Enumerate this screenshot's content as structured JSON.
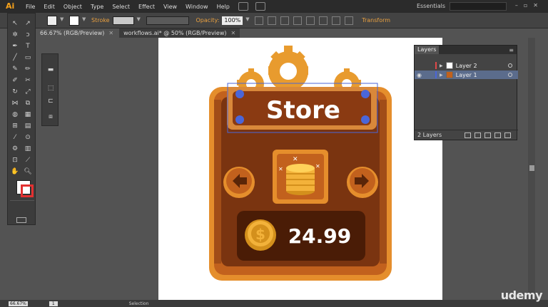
{
  "app": {
    "logo": "Ai"
  },
  "menu": [
    "File",
    "Edit",
    "Object",
    "Type",
    "Select",
    "Effect",
    "View",
    "Window",
    "Help"
  ],
  "workspace": "Essentials",
  "control_bar": {
    "stroke_label": "Stroke",
    "opacity_label": "Opacity:",
    "opacity_value": "100%",
    "transform_label": "Transform"
  },
  "tabs": [
    {
      "label": "66.67% (RGB/Preview)"
    },
    {
      "label": "workflows.ai* @ 50% (RGB/Preview)"
    }
  ],
  "artwork": {
    "title": "Store",
    "price": "24.99",
    "currency_symbol": "$"
  },
  "layers_panel": {
    "title": "Layers",
    "layers": [
      {
        "name": "Layer 2",
        "color": "#e04848"
      },
      {
        "name": "Layer 1",
        "color": "#4a66d8"
      }
    ],
    "count": "2 Layers"
  },
  "status": {
    "zoom": "66.67%",
    "page": "1",
    "tool": "Selection"
  },
  "watermark": "udemy",
  "colors": {
    "accent": "#e9a040",
    "wood_dark": "#7a3410",
    "wood_light": "#c2611d",
    "gold": "#f3b23a"
  }
}
